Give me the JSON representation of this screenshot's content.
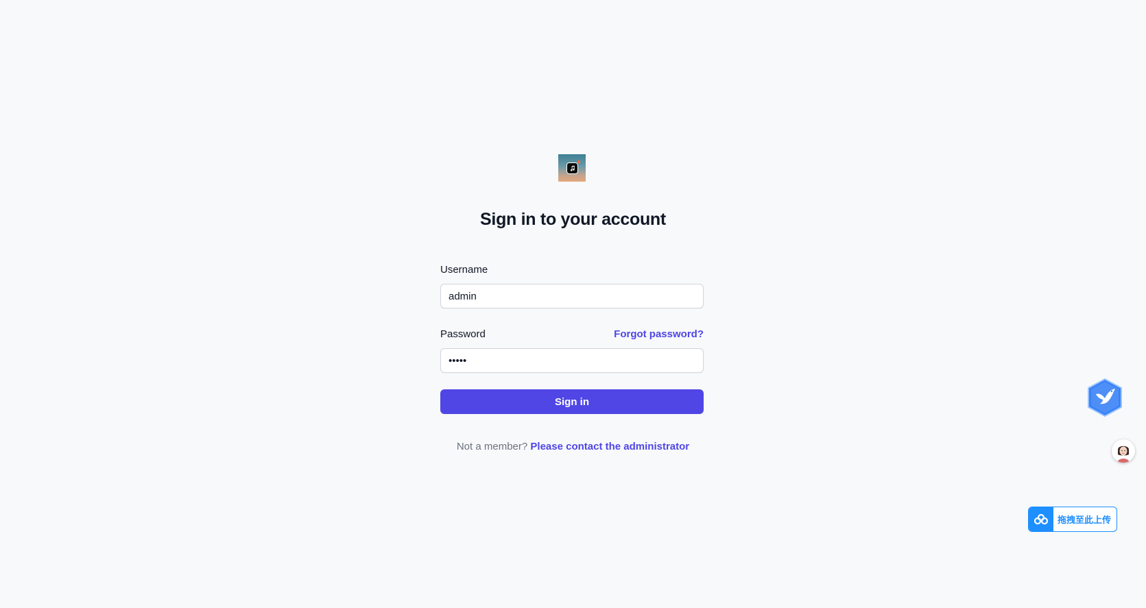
{
  "app": {
    "title": "Sign in to your account"
  },
  "form": {
    "username_label": "Username",
    "username_value": "admin",
    "password_label": "Password",
    "password_value": "•••••",
    "forgot_password_link": "Forgot password?",
    "submit_label": "Sign in"
  },
  "footer": {
    "prompt": "Not a member?",
    "contact_link": "Please contact the administrator"
  },
  "widgets": {
    "upload_label": "拖拽至此上传"
  },
  "colors": {
    "accent": "#4f46e5",
    "background": "#f8f9fb",
    "upload_blue": "#1e8fff"
  }
}
